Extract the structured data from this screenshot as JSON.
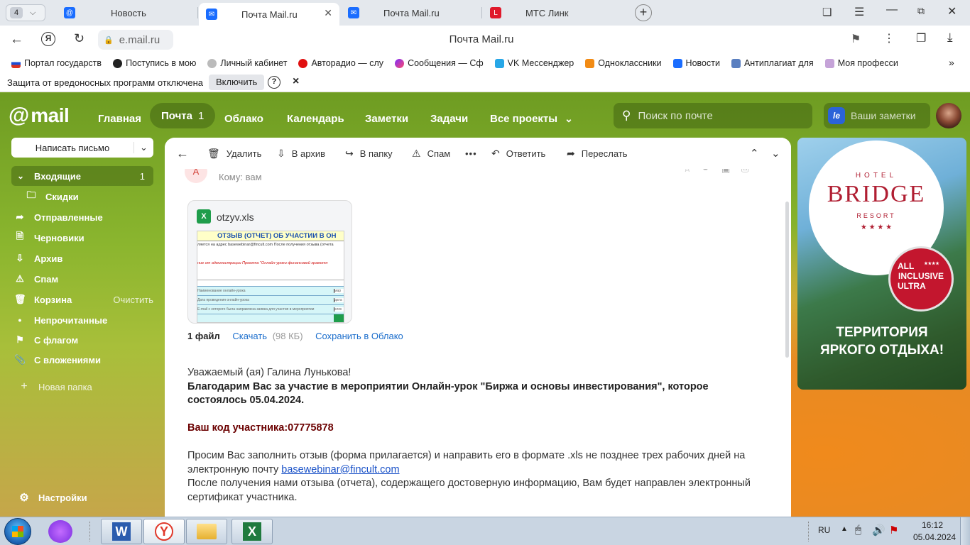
{
  "browser": {
    "tab_counter": "4",
    "tabs": [
      {
        "label": "Новость"
      },
      {
        "label": "Почта Mail.ru"
      },
      {
        "label": "Почта Mail.ru"
      },
      {
        "label": "МТС Линк"
      }
    ],
    "address": "e.mail.ru",
    "page_title": "Почта Mail.ru",
    "bookmarks": [
      {
        "label": "Портал государств"
      },
      {
        "label": "Поступись в мою"
      },
      {
        "label": "Личный кабинет"
      },
      {
        "label": "Авторадио — слу"
      },
      {
        "label": "Сообщения — Сф"
      },
      {
        "label": "VK Мессенджер"
      },
      {
        "label": "Одноклассники"
      },
      {
        "label": "Новости"
      },
      {
        "label": "Антиплагиат для"
      },
      {
        "label": "Моя професси"
      }
    ],
    "protection": {
      "text": "Защита от вредоносных программ отключена",
      "enable_label": "Включить",
      "help": "?",
      "close": "×"
    }
  },
  "mail": {
    "logo": "mail",
    "nav": {
      "home": "Главная",
      "mail": "Почта",
      "mail_count": "1",
      "cloud": "Облако",
      "calendar": "Календарь",
      "notes": "Заметки",
      "tasks": "Задачи",
      "all_projects": "Все проекты"
    },
    "search_placeholder": "Поиск по почте",
    "notes_widget": "Ваши заметки",
    "compose": "Написать письмо",
    "folders": {
      "inbox": "Входящие",
      "inbox_count": "1",
      "discounts": "Скидки",
      "sent": "Отправленные",
      "drafts": "Черновики",
      "archive": "Архив",
      "spam": "Спам",
      "trash": "Корзина",
      "trash_clear": "Очистить",
      "unread": "Непрочитанные",
      "flagged": "С флагом",
      "attachments": "С вложениями",
      "new_folder": "Новая папка",
      "settings": "Настройки"
    },
    "toolbar": {
      "delete": "Удалить",
      "archive": "В архив",
      "move": "В папку",
      "spam": "Спам",
      "more": "•••",
      "reply": "Ответить",
      "forward": "Переслать"
    },
    "letter": {
      "avatar": "А",
      "to": "Кому: вам",
      "file_name": "otzyv.xls",
      "preview_title": "ОТЗЫВ (ОТЧЕТ) ОБ УЧАСТИИ В ОН",
      "preview_line1": "ляется на адрес basewebinar@fincult.com После получения отзыва (отчета",
      "preview_line2": "ние от администрации Проекта \"Онлайн-уроки финансовой грамотн",
      "preview_row1": "Наименование онлайн-урока",
      "preview_row2": "Дата проведения онлайн-урока",
      "preview_row3": "E-mail с которого была направлена заявка для участия в мероприятии",
      "preview_cell1": "мар",
      "preview_cell2": "дата",
      "preview_cell3": "элек",
      "files_count": "1 файл",
      "download": "Скачать",
      "download_size": "(98 КБ)",
      "save_cloud": "Сохранить в Облако",
      "greeting": "Уважаемый (ая) Галина Лунькова!",
      "thanks": "Благодарим Вас за участие в мероприятии Онлайн-урок \"Биржа и основы инвестирования\", которое состоялось 05.04.2024.",
      "code": "Ваш код участника:07775878",
      "request1": "Просим Вас заполнить отзыв (форма прилагается) и направить его в формате .xls не позднее трех рабочих дней на электронную почту",
      "email_link": "basewebinar@fincult.com",
      "request2": "После получения нами отзыва (отчета), содержащего достоверную информацию, Вам будет направлен электронный сертификат участника."
    }
  },
  "ad": {
    "hotel": "HOTEL",
    "brand": "BRIDGE",
    "resort": "RESORT",
    "stars": "★ ★ ★ ★",
    "badge_stars": "★★★★",
    "badge1": "ALL",
    "badge2": "INCLUSIVE",
    "badge3": "ULTRA",
    "slogan1": "ТЕРРИТОРИЯ",
    "slogan2": "ЯРКОГО ОТДЫХА!"
  },
  "taskbar": {
    "lang": "RU",
    "time": "16:12",
    "date": "05.04.2024"
  }
}
